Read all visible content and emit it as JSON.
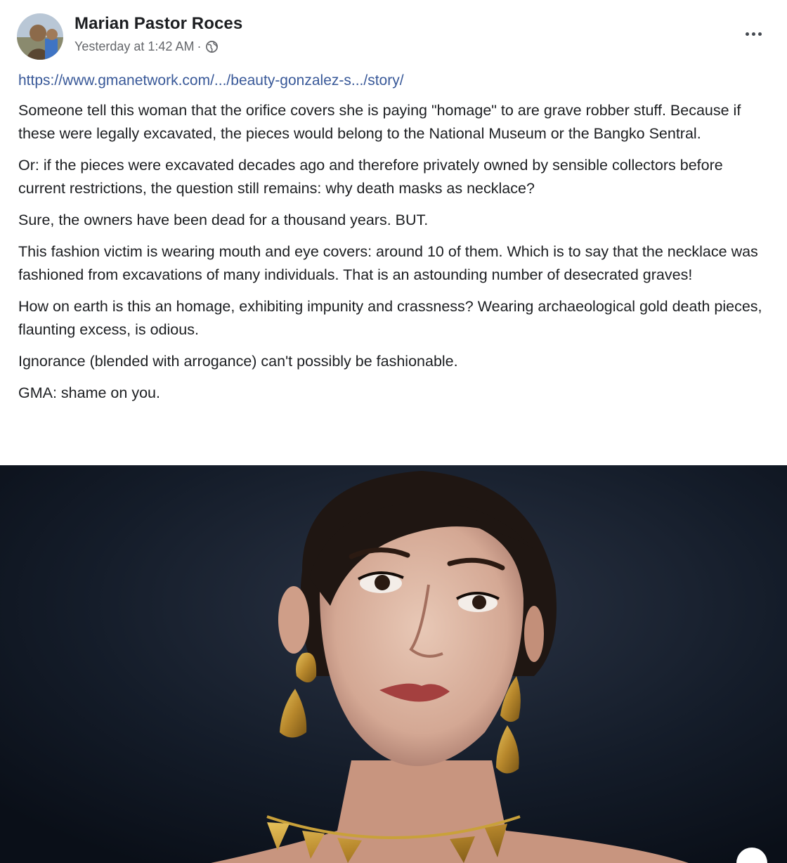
{
  "post": {
    "author": "Marian Pastor Roces",
    "timestamp": "Yesterday at 1:42 AM",
    "separator": "·",
    "privacy_icon": "globe-icon",
    "more_icon": "more-options-icon",
    "link": "https://www.gmanetwork.com/.../beauty-gonzalez-s.../story/",
    "paragraphs": [
      "Someone tell this woman that the orifice covers she is paying \"homage\" to are grave robber stuff. Because if these were legally excavated, the pieces would belong to the National Museum or the Bangko Sentral.",
      "Or: if the pieces were excavated decades ago and therefore privately owned by sensible collectors before current restrictions, the question still remains: why death masks as necklace?",
      "Sure, the owners have been dead for a thousand years. BUT.",
      "This fashion victim is wearing mouth and eye covers: around 10 of them. Which is to say that the necklace was fashioned from excavations of many individuals. That is an astounding number of desecrated graves!",
      "How on earth is this an homage, exhibiting impunity and crassness? Wearing archaeological gold death pieces, flaunting excess, is odious.",
      "Ignorance (blended with arrogance) can't possibly be fashionable.",
      "GMA: shame on you."
    ]
  },
  "colors": {
    "link": "#385898",
    "text": "#1c1e21",
    "meta": "#65676b",
    "photo_background": "#101827",
    "gold": "#c9a13a"
  }
}
